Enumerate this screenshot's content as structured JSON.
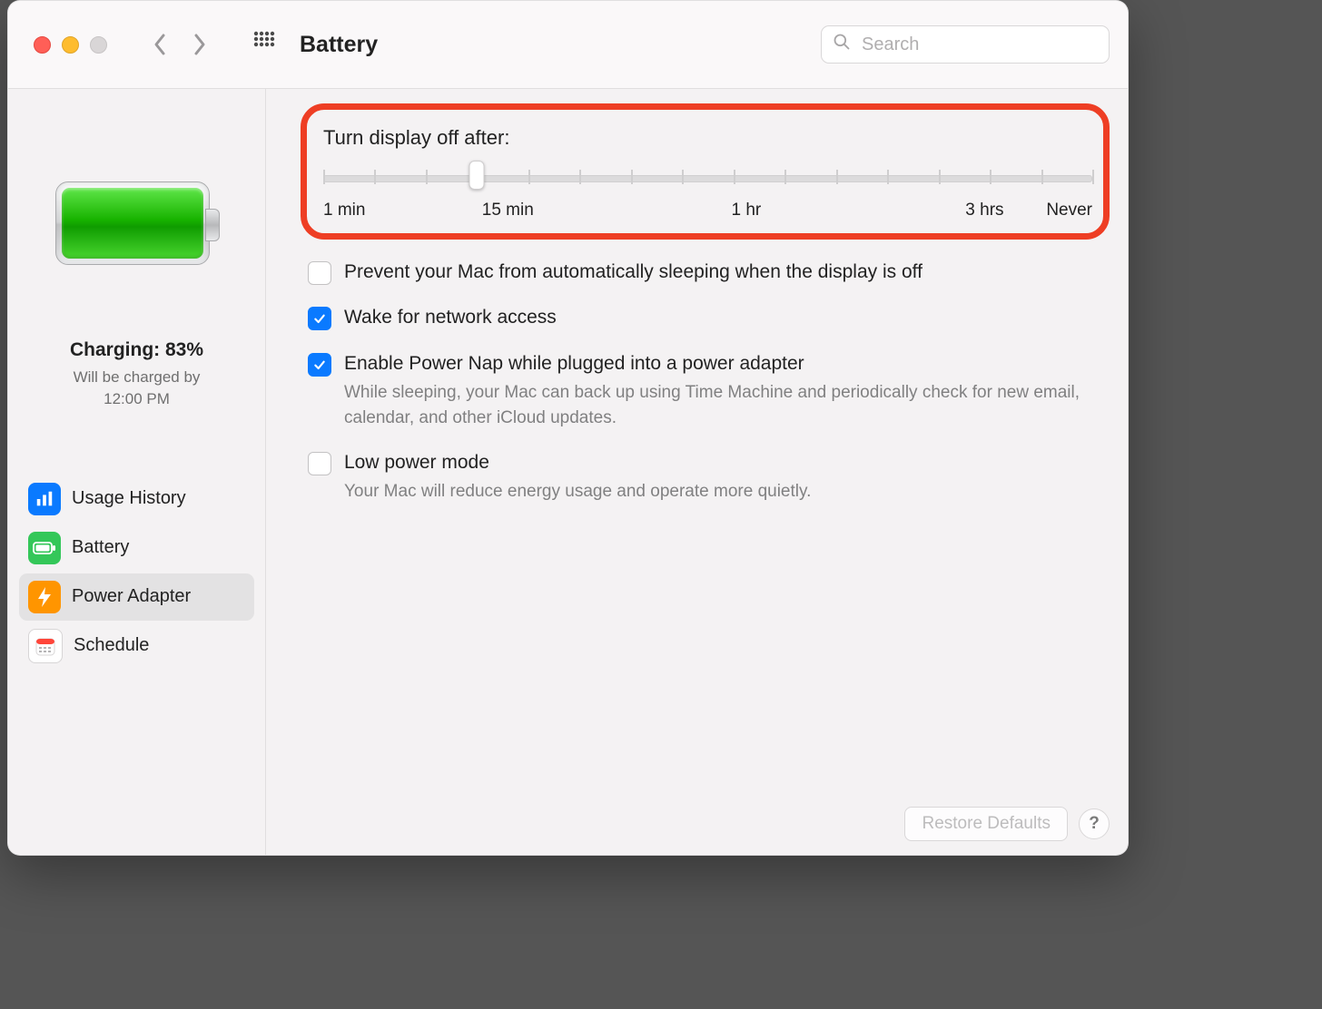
{
  "toolbar": {
    "title": "Battery",
    "search_placeholder": "Search"
  },
  "sidebar": {
    "status_title": "Charging: 83%",
    "status_sub_l1": "Will be charged by",
    "status_sub_l2": "12:00 PM",
    "items": [
      {
        "label": "Usage History",
        "icon": "chart-bar-icon",
        "bg": "blue",
        "selected": false
      },
      {
        "label": "Battery",
        "icon": "battery-full-icon",
        "bg": "green",
        "selected": false
      },
      {
        "label": "Power Adapter",
        "icon": "bolt-icon",
        "bg": "orange",
        "selected": true
      },
      {
        "label": "Schedule",
        "icon": "calendar-icon",
        "bg": "white",
        "selected": false
      }
    ]
  },
  "slider": {
    "title": "Turn display off after:",
    "value_index": 3,
    "tick_count": 16,
    "labels": [
      {
        "text": "1 min",
        "pos": 0
      },
      {
        "text": "15 min",
        "pos": 24
      },
      {
        "text": "1 hr",
        "pos": 55
      },
      {
        "text": "3 hrs",
        "pos": 86
      },
      {
        "text": "Never",
        "pos": 100
      }
    ]
  },
  "options": [
    {
      "label": "Prevent your Mac from automatically sleeping when the display is off",
      "checked": false,
      "desc": ""
    },
    {
      "label": "Wake for network access",
      "checked": true,
      "desc": ""
    },
    {
      "label": "Enable Power Nap while plugged into a power adapter",
      "checked": true,
      "desc": "While sleeping, your Mac can back up using Time Machine and periodically check for new email, calendar, and other iCloud updates."
    },
    {
      "label": "Low power mode",
      "checked": false,
      "desc": "Your Mac will reduce energy usage and operate more quietly."
    }
  ],
  "footer": {
    "restore": "Restore Defaults",
    "help": "?"
  }
}
